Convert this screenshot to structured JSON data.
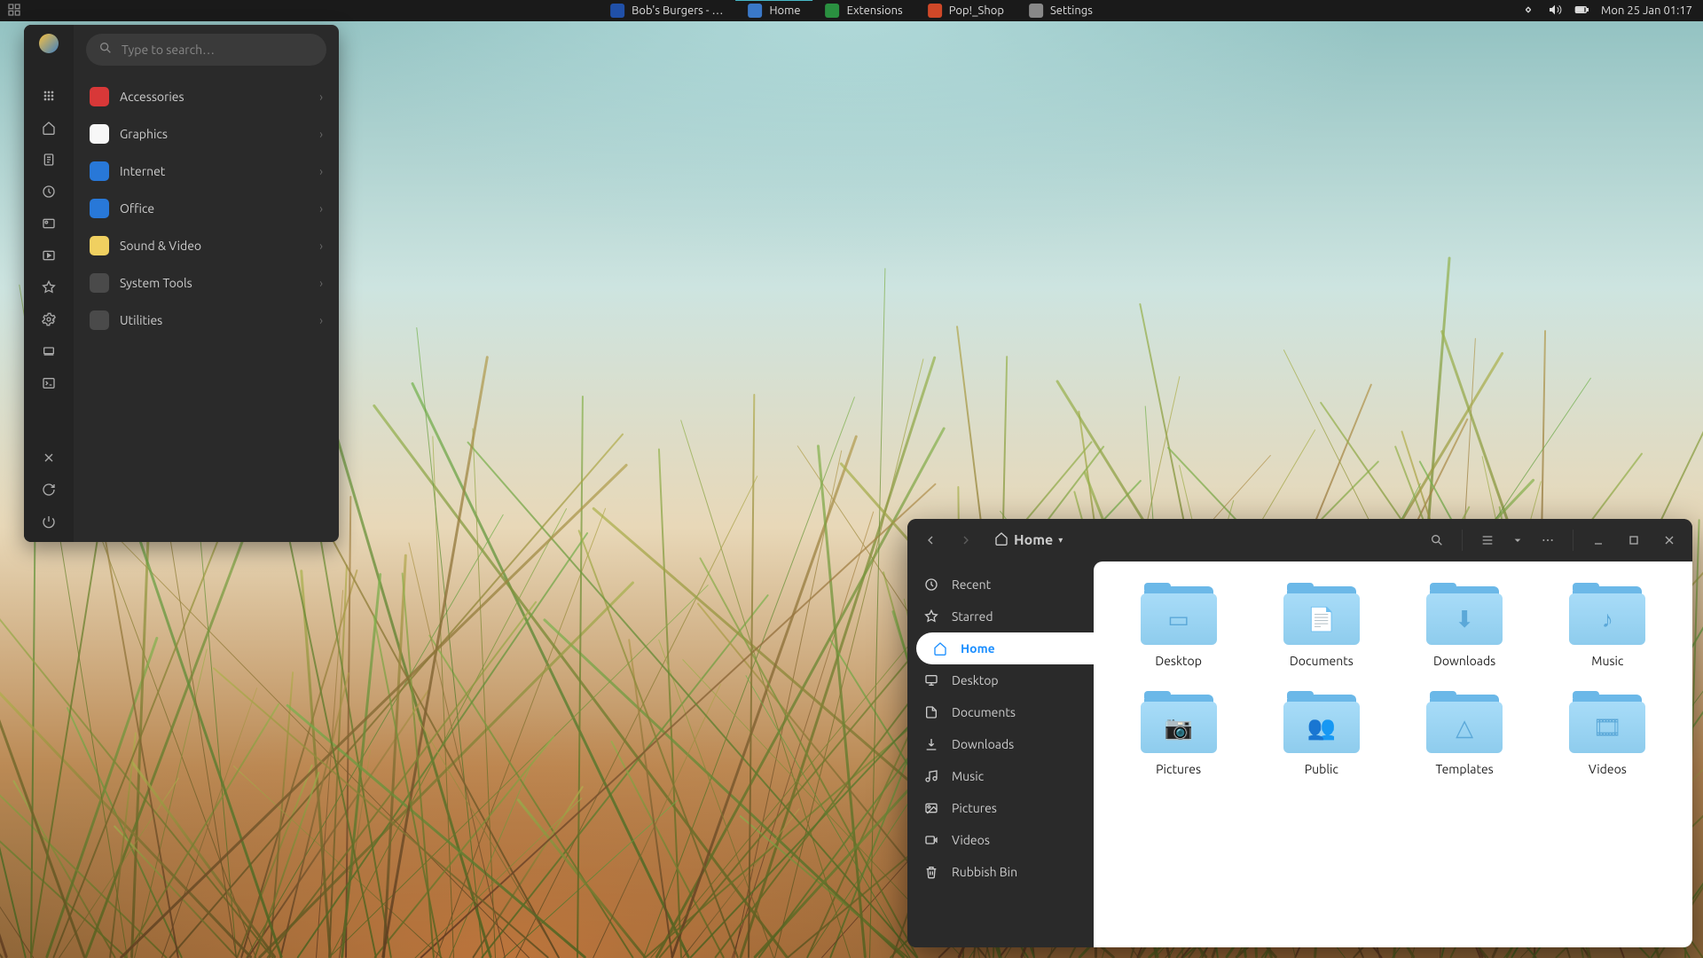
{
  "panel": {
    "tasks": [
      {
        "label": "Bob's Burgers - …",
        "icon_color": "#2050a8",
        "active": false
      },
      {
        "label": "Home",
        "icon_color": "#3a78c8",
        "active": true
      },
      {
        "label": "Extensions",
        "icon_color": "#2a9040",
        "active": false
      },
      {
        "label": "Pop!_Shop",
        "icon_color": "#d04828",
        "active": false
      },
      {
        "label": "Settings",
        "icon_color": "#888888",
        "active": false
      }
    ],
    "datetime": "Mon 25 Jan  01:17"
  },
  "launcher": {
    "search_placeholder": "Type to search…",
    "categories": [
      {
        "label": "Accessories",
        "icon_bg": "#d83838"
      },
      {
        "label": "Graphics",
        "icon_bg": "#f7f7f7"
      },
      {
        "label": "Internet",
        "icon_bg": "#2878d8"
      },
      {
        "label": "Office",
        "icon_bg": "#2878d8"
      },
      {
        "label": "Sound & Video",
        "icon_bg": "#f0d060"
      },
      {
        "label": "System Tools",
        "icon_bg": "#4a4a4a"
      },
      {
        "label": "Utilities",
        "icon_bg": "#4a4a4a"
      }
    ],
    "rail_icons": [
      "apps-icon",
      "home-icon",
      "documents-icon",
      "clock-icon",
      "pictures-icon",
      "videos-icon",
      "favorites-icon",
      "settings-icon",
      "devices-icon",
      "terminal-icon"
    ],
    "rail_bottom": [
      "close-icon",
      "restart-icon",
      "power-icon"
    ]
  },
  "filemanager": {
    "header": {
      "path_label": "Home"
    },
    "sidebar": [
      {
        "label": "Recent",
        "icon": "clock-icon",
        "active": false
      },
      {
        "label": "Starred",
        "icon": "star-icon",
        "active": false
      },
      {
        "label": "Home",
        "icon": "home-icon",
        "active": true
      },
      {
        "label": "Desktop",
        "icon": "desktop-icon",
        "active": false
      },
      {
        "label": "Documents",
        "icon": "document-icon",
        "active": false
      },
      {
        "label": "Downloads",
        "icon": "download-icon",
        "active": false
      },
      {
        "label": "Music",
        "icon": "music-icon",
        "active": false
      },
      {
        "label": "Pictures",
        "icon": "picture-icon",
        "active": false
      },
      {
        "label": "Videos",
        "icon": "video-icon",
        "active": false
      },
      {
        "label": "Rubbish Bin",
        "icon": "trash-icon",
        "active": false
      }
    ],
    "folders": [
      {
        "label": "Desktop",
        "glyph": "▭"
      },
      {
        "label": "Documents",
        "glyph": "📄"
      },
      {
        "label": "Downloads",
        "glyph": "⬇"
      },
      {
        "label": "Music",
        "glyph": "♪"
      },
      {
        "label": "Pictures",
        "glyph": "📷"
      },
      {
        "label": "Public",
        "glyph": "👥"
      },
      {
        "label": "Templates",
        "glyph": "△"
      },
      {
        "label": "Videos",
        "glyph": "🎞"
      }
    ]
  }
}
